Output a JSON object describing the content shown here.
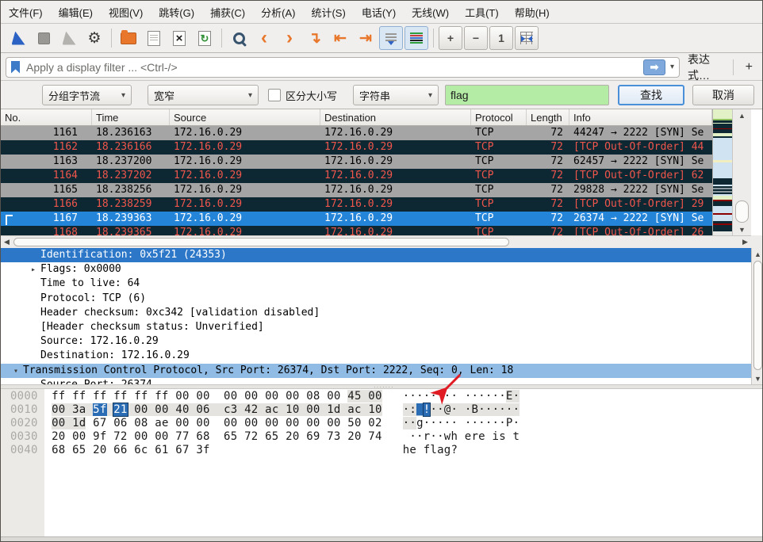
{
  "menu": {
    "items": [
      "文件(F)",
      "编辑(E)",
      "视图(V)",
      "跳转(G)",
      "捕获(C)",
      "分析(A)",
      "统计(S)",
      "电话(Y)",
      "无线(W)",
      "工具(T)",
      "帮助(H)"
    ]
  },
  "toolbar": {
    "items": [
      {
        "name": "capture-start-icon",
        "icon": "fin"
      },
      {
        "name": "capture-stop-icon",
        "icon": "stop"
      },
      {
        "name": "capture-restart-icon",
        "icon": "fin-gray"
      },
      {
        "name": "capture-options-icon",
        "icon": "gear"
      },
      {
        "type": "sep"
      },
      {
        "name": "file-open-icon",
        "icon": "folder"
      },
      {
        "name": "file-save-icon",
        "icon": "doc"
      },
      {
        "name": "file-close-icon",
        "icon": "doc-x"
      },
      {
        "name": "reload-file-icon",
        "icon": "doc-r"
      },
      {
        "type": "sep"
      },
      {
        "name": "find-packet-icon",
        "icon": "mag"
      },
      {
        "name": "go-back-icon",
        "icon": "chl"
      },
      {
        "name": "go-forward-icon",
        "icon": "chr"
      },
      {
        "name": "go-to-packet-icon",
        "icon": "jmp"
      },
      {
        "name": "go-first-packet-icon",
        "icon": "first"
      },
      {
        "name": "go-last-packet-icon",
        "icon": "last"
      },
      {
        "name": "autoscroll-icon",
        "icon": "mini-list",
        "state": "on"
      },
      {
        "name": "colorize-icon",
        "icon": "colorize",
        "state": "on"
      },
      {
        "type": "sep"
      },
      {
        "name": "zoom-in-icon",
        "icon": "plus",
        "state": "raised"
      },
      {
        "name": "zoom-out-icon",
        "icon": "minus",
        "state": "raised"
      },
      {
        "name": "zoom-original-icon",
        "icon": "one",
        "state": "raised"
      },
      {
        "name": "resize-columns-icon",
        "icon": "cols",
        "state": "raised"
      }
    ]
  },
  "filter_bar": {
    "placeholder": "Apply a display filter ... <Ctrl-/>",
    "apply_arrow": "➡",
    "caret": "▾",
    "expression_label": "表达式…",
    "add_label": "+"
  },
  "find_bar": {
    "scope_value": "分组字节流",
    "width_value": "宽窄",
    "case_label": "区分大小写",
    "type_value": "字符串",
    "query": "flag",
    "find_label": "查找",
    "cancel_label": "取消",
    "caret": "▾"
  },
  "packet_list": {
    "columns": [
      "No.",
      "Time",
      "Source",
      "Destination",
      "Protocol",
      "Length",
      "Info"
    ],
    "rows": [
      {
        "no": "1161",
        "time": "18.236163",
        "source": "172.16.0.29",
        "destination": "172.16.0.29",
        "protocol": "TCP",
        "length": "72",
        "info": "44247 → 2222 [SYN] Se",
        "style": "gray"
      },
      {
        "no": "1162",
        "time": "18.236166",
        "source": "172.16.0.29",
        "destination": "172.16.0.29",
        "protocol": "TCP",
        "length": "72",
        "info": "[TCP Out-Of-Order] 44",
        "style": "bad"
      },
      {
        "no": "1163",
        "time": "18.237200",
        "source": "172.16.0.29",
        "destination": "172.16.0.29",
        "protocol": "TCP",
        "length": "72",
        "info": "62457 → 2222 [SYN] Se",
        "style": "gray"
      },
      {
        "no": "1164",
        "time": "18.237202",
        "source": "172.16.0.29",
        "destination": "172.16.0.29",
        "protocol": "TCP",
        "length": "72",
        "info": "[TCP Out-Of-Order] 62",
        "style": "bad"
      },
      {
        "no": "1165",
        "time": "18.238256",
        "source": "172.16.0.29",
        "destination": "172.16.0.29",
        "protocol": "TCP",
        "length": "72",
        "info": "29828 → 2222 [SYN] Se",
        "style": "gray"
      },
      {
        "no": "1166",
        "time": "18.238259",
        "source": "172.16.0.29",
        "destination": "172.16.0.29",
        "protocol": "TCP",
        "length": "72",
        "info": "[TCP Out-Of-Order] 29",
        "style": "bad"
      },
      {
        "no": "1167",
        "time": "18.239363",
        "source": "172.16.0.29",
        "destination": "172.16.0.29",
        "protocol": "TCP",
        "length": "72",
        "info": "26374 → 2222 [SYN] Se",
        "style": "selected",
        "mark": true
      },
      {
        "no": "1168",
        "time": "18.239365",
        "source": "172.16.0.29",
        "destination": "172.16.0.29",
        "protocol": "TCP",
        "length": "72",
        "info": "[TCP Out-Of-Order] 26",
        "style": "bad"
      }
    ],
    "minimap_stripes": [
      [
        12,
        "#e2f1c6"
      ],
      [
        2,
        "#8fc05e"
      ],
      [
        3,
        "#0d2832"
      ],
      [
        1,
        "#e2f1c6"
      ],
      [
        6,
        "#0d2832"
      ],
      [
        1,
        "#8a0000"
      ],
      [
        5,
        "#0d2832"
      ],
      [
        4,
        "#e2f1c6"
      ],
      [
        2,
        "#0d2832"
      ],
      [
        28,
        "#cfe3f2"
      ],
      [
        3,
        "#f2eec0"
      ],
      [
        20,
        "#cfe3f2"
      ],
      [
        8,
        "#0d2832"
      ],
      [
        2,
        "#cfe3f2"
      ],
      [
        2,
        "#0d2832"
      ],
      [
        2,
        "#8a98a0"
      ],
      [
        2,
        "#0d2832"
      ],
      [
        2,
        "#8a98a0"
      ],
      [
        2,
        "#0d2832"
      ],
      [
        2,
        "#cfe3f2"
      ],
      [
        5,
        "#e2f1c6"
      ],
      [
        2,
        "#8a0000"
      ],
      [
        6,
        "#0d2832"
      ],
      [
        9,
        "#cfe3f2"
      ],
      [
        2,
        "#8a0000"
      ],
      [
        8,
        "#cfe3f2"
      ],
      [
        3,
        "#0d2832"
      ],
      [
        2,
        "#8a0000"
      ],
      [
        8,
        "#0d2832"
      ],
      [
        5,
        "#e8e8e6"
      ]
    ]
  },
  "detail_pane": {
    "lines": [
      {
        "text": "Identification: 0x5f21 (24353)",
        "level": 2,
        "expander": "",
        "style": "selected"
      },
      {
        "text": "Flags: 0x0000",
        "level": 2,
        "expander": "right",
        "style": ""
      },
      {
        "text": "Time to live: 64",
        "level": 2,
        "expander": "",
        "style": ""
      },
      {
        "text": "Protocol: TCP (6)",
        "level": 2,
        "expander": "",
        "style": ""
      },
      {
        "text": "Header checksum: 0xc342 [validation disabled]",
        "level": 2,
        "expander": "",
        "style": ""
      },
      {
        "text": "[Header checksum status: Unverified]",
        "level": 2,
        "expander": "",
        "style": ""
      },
      {
        "text": "Source: 172.16.0.29",
        "level": 2,
        "expander": "",
        "style": ""
      },
      {
        "text": "Destination: 172.16.0.29",
        "level": 2,
        "expander": "",
        "style": ""
      },
      {
        "text": "Transmission Control Protocol, Src Port: 26374, Dst Port: 2222, Seq: 0, Len: 18",
        "level": 1,
        "expander": "down",
        "style": "highlight"
      },
      {
        "text": "Source Port: 26374",
        "level": 2,
        "expander": "",
        "style": ""
      }
    ]
  },
  "hex_pane": {
    "rows": [
      {
        "segments": [
          [
            "o",
            "0000"
          ],
          [
            "p",
            "  ff ff ff ff ff ff 00 00  00 00 00 00 08 00 "
          ],
          [
            "s",
            "45 00"
          ],
          [
            "p",
            "   "
          ],
          [
            "p",
            "········ ······"
          ],
          [
            "s",
            "E·"
          ]
        ]
      },
      {
        "segments": [
          [
            "o",
            "0010"
          ],
          [
            "p",
            "  "
          ],
          [
            "s",
            "00 3a "
          ],
          [
            "b",
            "5f"
          ],
          [
            "s",
            " "
          ],
          [
            "B",
            "21"
          ],
          [
            "s",
            " 00 00 40 06  c3 42 ac 10 00 1d ac 10"
          ],
          [
            "p",
            "   "
          ],
          [
            "s",
            "·:"
          ],
          [
            "b",
            "_"
          ],
          [
            "B",
            "!"
          ],
          [
            "s",
            "··@· ·B······"
          ]
        ]
      },
      {
        "segments": [
          [
            "o",
            "0020"
          ],
          [
            "p",
            "  "
          ],
          [
            "s",
            "00 1d"
          ],
          [
            "p",
            " 67 06 08 ae 00 00  00 00 00 00 00 00 50 02   "
          ],
          [
            "s",
            "··"
          ],
          [
            "p",
            "g····· ······P·"
          ]
        ]
      },
      {
        "segments": [
          [
            "o",
            "0030"
          ],
          [
            "p",
            "  20 00 9f 72 00 00 77 68  65 72 65 20 69 73 20 74    ··r··wh ere is t"
          ]
        ]
      },
      {
        "segments": [
          [
            "o",
            "0040"
          ],
          [
            "p",
            "  68 65 20 66 6c 61 67 3f                            he flag?"
          ]
        ]
      }
    ]
  },
  "annotation": {
    "type": "red-arrow",
    "color": "#e01b24"
  },
  "colors": {
    "selection_blue": "#2484d8",
    "detail_selected_blue": "#2c77c8",
    "detail_highlight_blue": "#8fbbe4",
    "hex_selected_blue": "#2a6db5",
    "bad_tcp_bg": "#0d2832",
    "bad_tcp_fg": "#f0564c",
    "gray_row_bg": "#a5a5a5",
    "found_green": "#b4eca6",
    "chrome_bg": "#f0efed"
  }
}
